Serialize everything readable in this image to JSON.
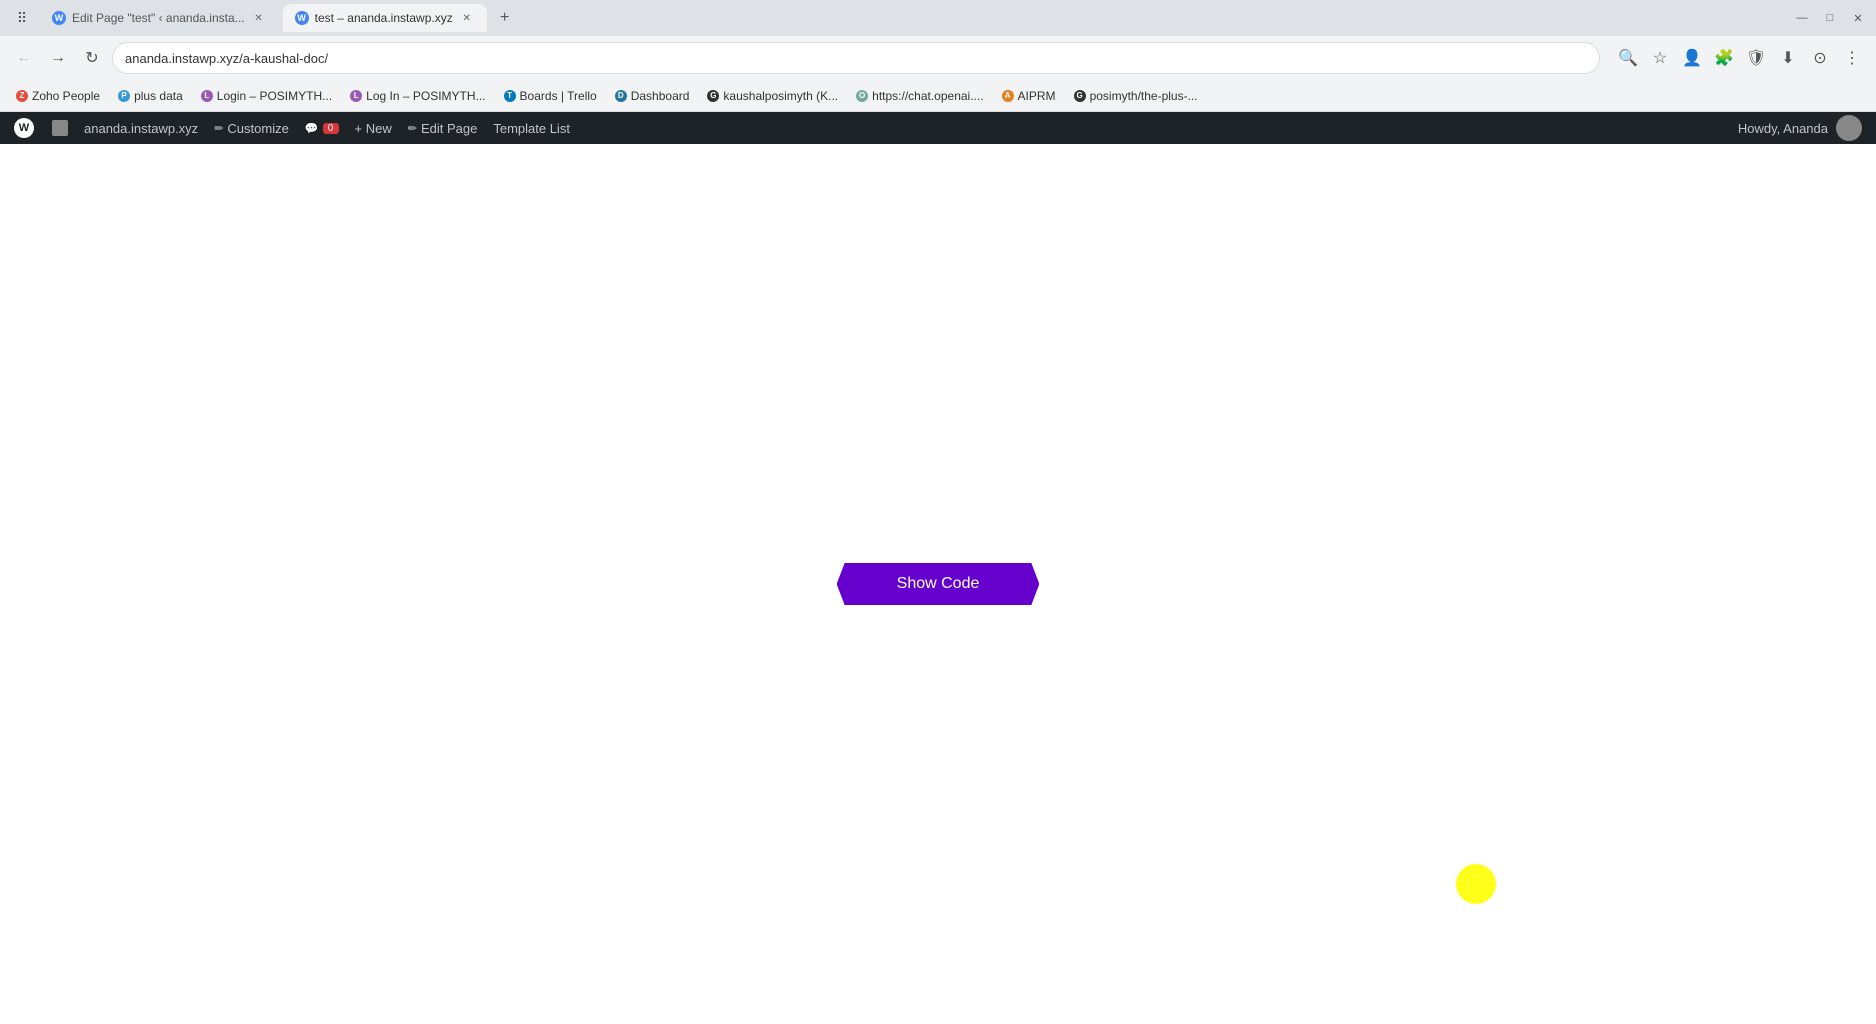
{
  "browser": {
    "tabs": [
      {
        "id": "tab1",
        "label": "Edit Page \"test\" ‹ ananda.insta...",
        "active": false,
        "favicon_color": "#4285f4",
        "favicon_char": "W"
      },
      {
        "id": "tab2",
        "label": "test – ananda.instawp.xyz",
        "active": true,
        "favicon_color": "#4285f4",
        "favicon_char": "W"
      }
    ],
    "url": "ananda.instawp.xyz/a-kaushal-doc/",
    "window_controls": {
      "minimize": "—",
      "maximize": "□",
      "close": "✕"
    }
  },
  "bookmarks": [
    {
      "label": "Zoho People",
      "color": "#e74c3c"
    },
    {
      "label": "plus data",
      "color": "#3498db"
    },
    {
      "label": "Login – POSIMYTH...",
      "color": "#9b59b6"
    },
    {
      "label": "Log In – POSIMYTH...",
      "color": "#9b59b6"
    },
    {
      "label": "Boards | Trello",
      "color": "#0079bf"
    },
    {
      "label": "Dashboard",
      "color": "#21759b"
    },
    {
      "label": "kaushalposimyth (K...",
      "color": "#333"
    },
    {
      "label": "https://chat.openai....",
      "color": "#74aa9c"
    },
    {
      "label": "AIPRM",
      "color": "#e67e22"
    },
    {
      "label": "posimyth/the-plus-...",
      "color": "#333"
    }
  ],
  "wp_admin_bar": {
    "items": [
      {
        "id": "wp-logo",
        "label": ""
      },
      {
        "id": "site-name",
        "label": "ananda.instawp.xyz"
      },
      {
        "id": "customize",
        "label": "Customize"
      },
      {
        "id": "comments",
        "label": "0",
        "has_badge": true
      },
      {
        "id": "new",
        "label": "+ New"
      },
      {
        "id": "edit-page",
        "label": "Edit Page"
      },
      {
        "id": "template-list",
        "label": "Template List"
      }
    ],
    "user": "Howdy, Ananda"
  },
  "page": {
    "show_code_button": "Show Code",
    "button_color": "#6600cc"
  },
  "cursor": {
    "color": "#ffff00"
  }
}
